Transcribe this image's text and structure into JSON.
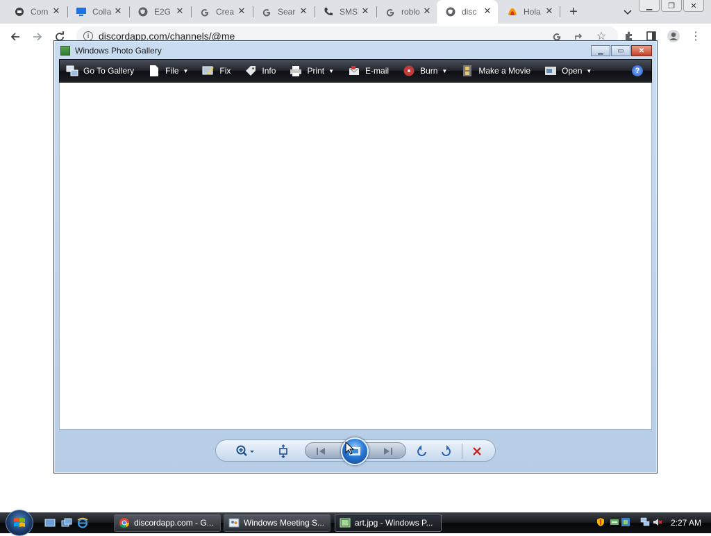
{
  "browser": {
    "tabs": [
      {
        "title": "Com",
        "icon": "roblox-studio-icon",
        "active": false
      },
      {
        "title": "Colla",
        "icon": "monitor-icon",
        "active": false
      },
      {
        "title": "E2G",
        "icon": "globe-icon",
        "active": false
      },
      {
        "title": "Crea",
        "icon": "google-icon",
        "active": false
      },
      {
        "title": "Sear",
        "icon": "google-icon",
        "active": false
      },
      {
        "title": "SMS",
        "icon": "phone-icon",
        "active": false
      },
      {
        "title": "roblo",
        "icon": "google-icon",
        "active": false
      },
      {
        "title": "disc",
        "icon": "globe-icon",
        "active": true
      },
      {
        "title": "Hola",
        "icon": "hola-icon",
        "active": false
      }
    ],
    "new_tab_label": "+",
    "url": "discordapp.com/channels/@me"
  },
  "photo_gallery": {
    "title": "Windows Photo Gallery",
    "commands": [
      {
        "label": "Go To Gallery",
        "icon": "gallery-icon",
        "dropdown": false
      },
      {
        "label": "File",
        "icon": "file-icon",
        "dropdown": true
      },
      {
        "label": "Fix",
        "icon": "fix-icon",
        "dropdown": false
      },
      {
        "label": "Info",
        "icon": "info-tag-icon",
        "dropdown": false
      },
      {
        "label": "Print",
        "icon": "printer-icon",
        "dropdown": true
      },
      {
        "label": "E-mail",
        "icon": "email-icon",
        "dropdown": false
      },
      {
        "label": "Burn",
        "icon": "disc-burn-icon",
        "dropdown": true
      },
      {
        "label": "Make a Movie",
        "icon": "film-icon",
        "dropdown": false
      },
      {
        "label": "Open",
        "icon": "open-icon",
        "dropdown": true
      }
    ],
    "help_label": "?"
  },
  "taskbar": {
    "buttons": [
      {
        "label": "discordapp.com - G...",
        "icon": "chrome-icon",
        "active": false
      },
      {
        "label": "Windows Meeting S...",
        "icon": "meeting-space-icon",
        "active": false
      },
      {
        "label": "art.jpg - Windows P...",
        "icon": "photo-gallery-icon",
        "active": true
      }
    ],
    "clock": "2:27 AM"
  }
}
